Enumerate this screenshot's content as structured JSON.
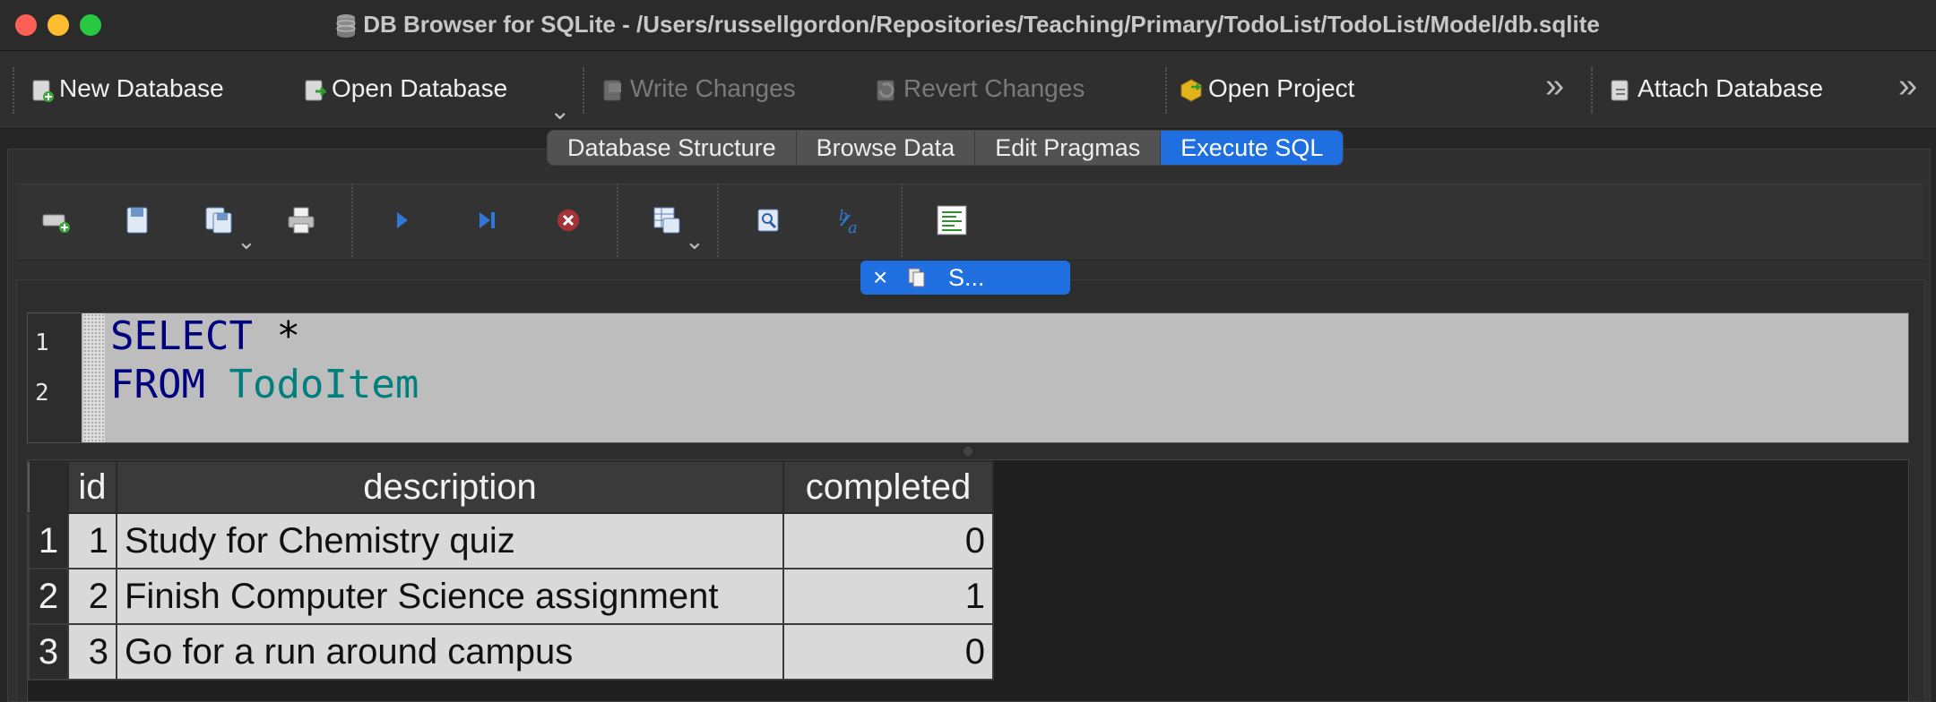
{
  "window": {
    "title": "DB Browser for SQLite - /Users/russellgordon/Repositories/Teaching/Primary/TodoList/TodoList/Model/db.sqlite"
  },
  "toolbar": {
    "new_database": "New Database",
    "open_database": "Open Database",
    "write_changes": "Write Changes",
    "revert_changes": "Revert Changes",
    "open_project": "Open Project",
    "attach_database": "Attach Database",
    "overflow_glyph": "»"
  },
  "tabs": [
    {
      "label": "Database Structure",
      "active": false
    },
    {
      "label": "Browse Data",
      "active": false
    },
    {
      "label": "Edit Pragmas",
      "active": false
    },
    {
      "label": "Execute SQL",
      "active": true
    }
  ],
  "sql_toolbar_icons": [
    "open-tab-icon",
    "open-sql-file-icon",
    "save-sql-file-icon",
    "print-icon",
    "execute-all-icon",
    "execute-current-line-icon",
    "stop-execution-icon",
    "save-results-icon",
    "find-icon",
    "find-replace-icon",
    "comment-icon"
  ],
  "query_tab": {
    "label": "S..."
  },
  "editor": {
    "line_numbers": [
      "1",
      "2"
    ],
    "line1": {
      "keyword": "SELECT",
      "rest": " *"
    },
    "line2": {
      "keyword": "FROM",
      "rest": " TodoItem"
    }
  },
  "results": {
    "columns": [
      "id",
      "description",
      "completed"
    ],
    "rows": [
      {
        "row": "1",
        "id": "1",
        "description": "Study for Chemistry quiz",
        "completed": "0"
      },
      {
        "row": "2",
        "id": "2",
        "description": "Finish Computer Science assignment",
        "completed": "1"
      },
      {
        "row": "3",
        "id": "3",
        "description": "Go for a run around campus",
        "completed": "0"
      }
    ]
  },
  "colors": {
    "accent": "#1f6fe0",
    "sql_keyword": "#00007f",
    "sql_identifier": "#007f7f"
  }
}
